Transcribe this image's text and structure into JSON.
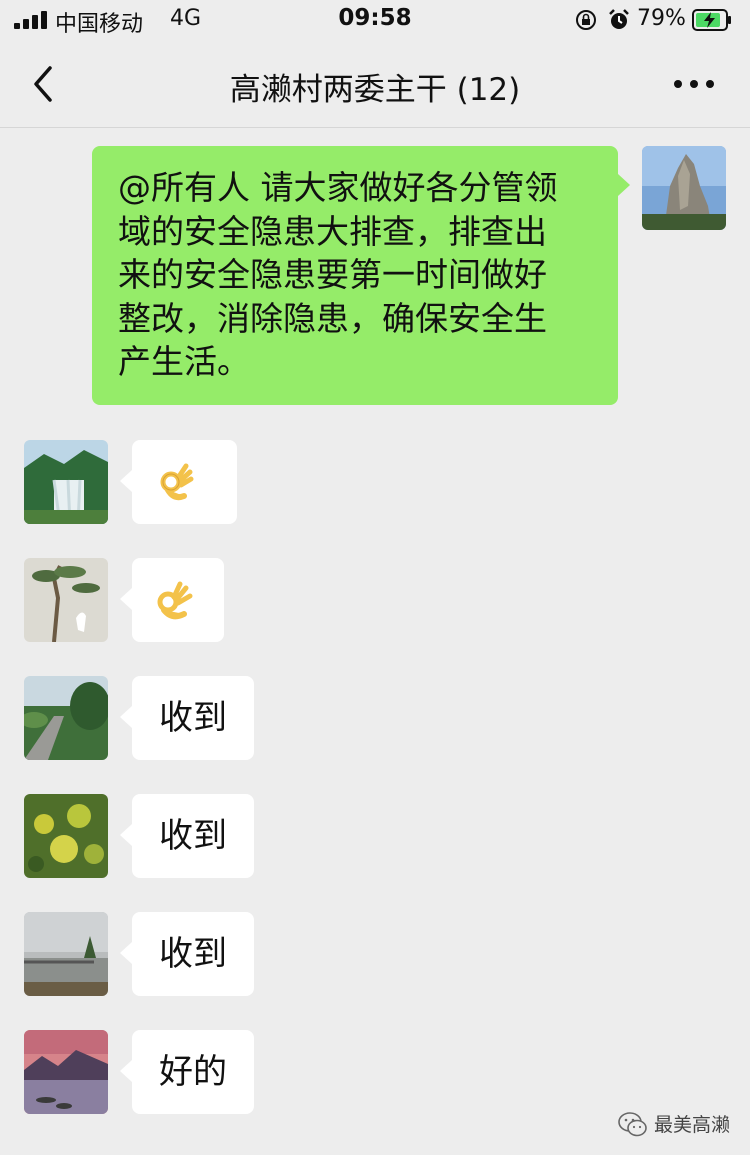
{
  "status_bar": {
    "carrier": "中国移动",
    "network": "4G",
    "time": "09:58",
    "battery": "79%"
  },
  "chat": {
    "title": "高濑村两委主干 (12)"
  },
  "messages": [
    {
      "sender": "self",
      "text": "@所有人  请大家做好各分管领域的安全隐患大排查，排查出来的安全隐患要第一时间做好整改，消除隐患，确保安全生产生活。"
    },
    {
      "sender": "other",
      "emoji": "ok-hand-emoji"
    },
    {
      "sender": "other",
      "emoji": "ok-hand-emoji"
    },
    {
      "sender": "other",
      "text": "收到"
    },
    {
      "sender": "other",
      "text": "收到"
    },
    {
      "sender": "other",
      "text": "收到"
    },
    {
      "sender": "other",
      "text": "好的"
    }
  ],
  "watermark": {
    "text": "最美高濑"
  },
  "colors": {
    "background": "#ededed",
    "sent_bubble": "#95ec69",
    "received_bubble": "#ffffff"
  }
}
